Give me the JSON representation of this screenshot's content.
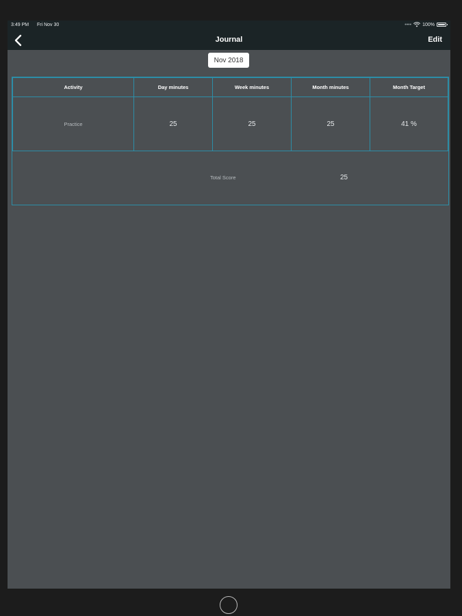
{
  "status_bar": {
    "time": "3:49 PM",
    "date": "Fri Nov 30",
    "battery": "100%"
  },
  "nav": {
    "title": "Journal",
    "edit_label": "Edit"
  },
  "month_picker": {
    "value": "Nov 2018"
  },
  "table": {
    "headers": [
      "Activity",
      "Day minutes",
      "Week minutes",
      "Month minutes",
      "Month Target"
    ],
    "rows": [
      {
        "activity": "Practice",
        "day": "25",
        "week": "25",
        "month": "25",
        "target": "41 %"
      }
    ],
    "total_label": "Total Score",
    "total_value": "25"
  },
  "colors": {
    "nav_bg": "#1b2426",
    "content_bg": "#4b4f52",
    "grid_line": "#2c8ea8",
    "outer_bezel": "#1c1c1c"
  }
}
